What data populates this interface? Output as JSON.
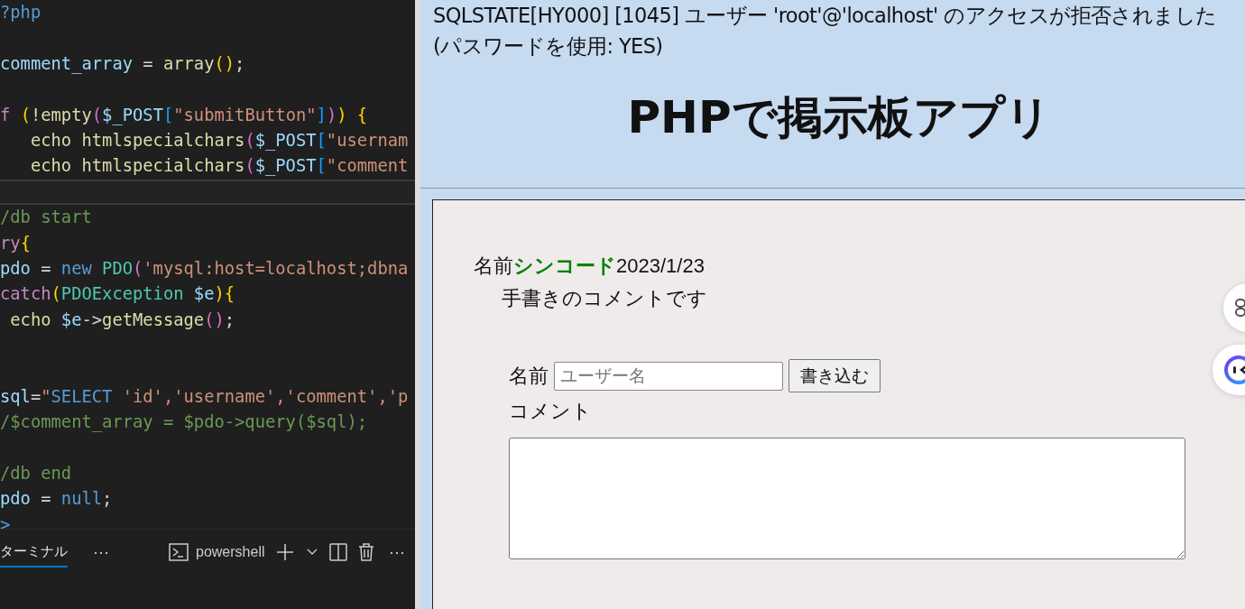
{
  "editor": {
    "lines": [
      {
        "kind": "code",
        "tokens": [
          {
            "text": "?php",
            "kind": "keyword"
          }
        ]
      },
      {
        "kind": "blank",
        "current": false
      },
      {
        "kind": "code",
        "tokens": [
          {
            "text": "comment_array",
            "kind": "variable"
          },
          {
            "text": " = ",
            "kind": "plain"
          },
          {
            "text": "array",
            "kind": "function"
          },
          {
            "text": "()",
            "kind": "bracket"
          },
          {
            "text": ";",
            "kind": "plain"
          }
        ]
      },
      {
        "kind": "blank",
        "current": false
      },
      {
        "kind": "code",
        "tokens": [
          {
            "text": "f ",
            "kind": "control"
          },
          {
            "text": "(",
            "kind": "bracket"
          },
          {
            "text": "!empty",
            "kind": "function"
          },
          {
            "text": "(",
            "kind": "bracket2"
          },
          {
            "text": "$_POST",
            "kind": "variable"
          },
          {
            "text": "[",
            "kind": "bracket3"
          },
          {
            "text": "\"submitButton\"",
            "kind": "string"
          },
          {
            "text": "]",
            "kind": "bracket3"
          },
          {
            "text": ")",
            "kind": "bracket2"
          },
          {
            "text": ")",
            "kind": "bracket"
          },
          {
            "text": " {",
            "kind": "bracket"
          }
        ]
      },
      {
        "kind": "code",
        "tokens": [
          {
            "text": "   echo htmlspecialchars",
            "kind": "function"
          },
          {
            "text": "(",
            "kind": "bracket2"
          },
          {
            "text": "$_POST",
            "kind": "variable"
          },
          {
            "text": "[",
            "kind": "bracket3"
          },
          {
            "text": "\"usernam",
            "kind": "string"
          }
        ]
      },
      {
        "kind": "code",
        "tokens": [
          {
            "text": "   echo htmlspecialchars",
            "kind": "function"
          },
          {
            "text": "(",
            "kind": "bracket2"
          },
          {
            "text": "$_POST",
            "kind": "variable"
          },
          {
            "text": "[",
            "kind": "bracket3"
          },
          {
            "text": "\"comment",
            "kind": "string"
          }
        ]
      },
      {
        "kind": "blank",
        "current": true
      },
      {
        "kind": "code",
        "tokens": [
          {
            "text": "/db start",
            "kind": "comment"
          }
        ]
      },
      {
        "kind": "code",
        "tokens": [
          {
            "text": "ry",
            "kind": "control"
          },
          {
            "text": "{",
            "kind": "bracket"
          }
        ]
      },
      {
        "kind": "code",
        "tokens": [
          {
            "text": "pdo",
            "kind": "variable"
          },
          {
            "text": " = ",
            "kind": "plain"
          },
          {
            "text": "new ",
            "kind": "keyword"
          },
          {
            "text": "PDO",
            "kind": "class"
          },
          {
            "text": "(",
            "kind": "bracket2"
          },
          {
            "text": "'mysql:host=localhost;dbna",
            "kind": "string"
          }
        ]
      },
      {
        "kind": "code",
        "tokens": [
          {
            "text": "catch",
            "kind": "control"
          },
          {
            "text": "(",
            "kind": "bracket"
          },
          {
            "text": "PDOException ",
            "kind": "class"
          },
          {
            "text": "$e",
            "kind": "variable"
          },
          {
            "text": "){",
            "kind": "bracket"
          }
        ]
      },
      {
        "kind": "code",
        "tokens": [
          {
            "text": " echo ",
            "kind": "function"
          },
          {
            "text": "$e",
            "kind": "variable"
          },
          {
            "text": "->",
            "kind": "plain"
          },
          {
            "text": "getMessage",
            "kind": "function"
          },
          {
            "text": "()",
            "kind": "bracket2"
          },
          {
            "text": ";",
            "kind": "plain"
          }
        ]
      },
      {
        "kind": "blank",
        "current": false
      },
      {
        "kind": "blank",
        "current": false
      },
      {
        "kind": "code",
        "tokens": [
          {
            "text": "sql",
            "kind": "variable"
          },
          {
            "text": "=",
            "kind": "plain"
          },
          {
            "text": "\"",
            "kind": "string"
          },
          {
            "text": "SELECT ",
            "kind": "keyword"
          },
          {
            "text": "'id','username','comment','p",
            "kind": "string"
          }
        ]
      },
      {
        "kind": "code",
        "tokens": [
          {
            "text": "/$comment_array = $pdo->query($sql);",
            "kind": "comment"
          }
        ]
      },
      {
        "kind": "blank",
        "current": false
      },
      {
        "kind": "code",
        "tokens": [
          {
            "text": "/db end",
            "kind": "comment"
          }
        ]
      },
      {
        "kind": "code",
        "tokens": [
          {
            "text": "pdo",
            "kind": "variable"
          },
          {
            "text": " = ",
            "kind": "plain"
          },
          {
            "text": "null",
            "kind": "keyword"
          },
          {
            "text": ";",
            "kind": "plain"
          }
        ]
      },
      {
        "kind": "code",
        "tokens": [
          {
            "text": ">",
            "kind": "keyword"
          }
        ]
      }
    ]
  },
  "panel": {
    "tabs": [
      {
        "label": "ターミナル",
        "selected": true
      }
    ],
    "more": "⋯",
    "terminal_name": "powershell",
    "actions_more": "⋯"
  },
  "browser": {
    "error": "SQLSTATE[HY000] [1045] ユーザー 'root'@'localhost' のアクセスが拒否されました(パスワードを使用: YES)",
    "title": "PHPで掲示板アプリ",
    "post": {
      "name_label": "名前",
      "name": "シンコード",
      "date": "2023/1/23",
      "comment": "手書きのコメントです"
    },
    "form": {
      "name_label": "名前",
      "name_placeholder": "ユーザー名",
      "submit": "書き込む",
      "comment_label": "コメント"
    }
  }
}
